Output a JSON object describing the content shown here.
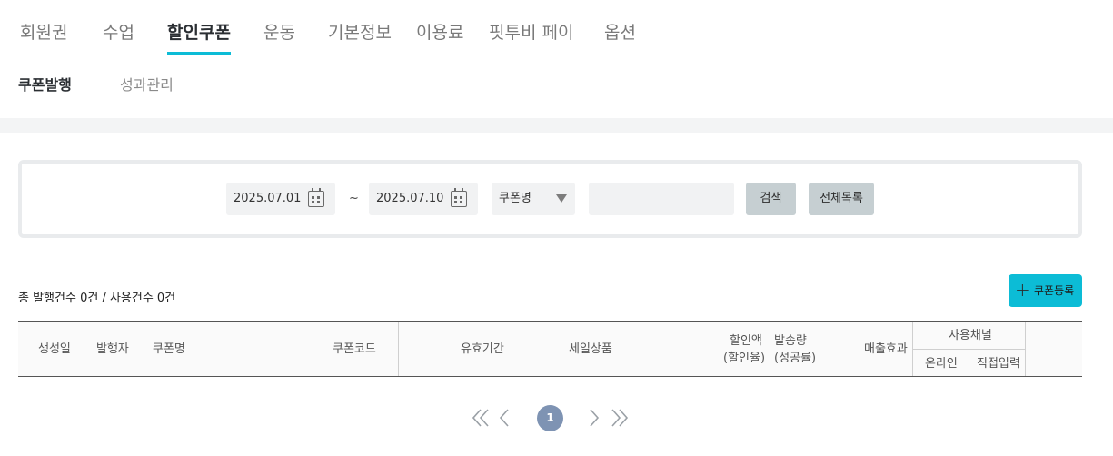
{
  "main_tabs": [
    {
      "label": "회원권",
      "active": false
    },
    {
      "label": "수업",
      "active": false
    },
    {
      "label": "할인쿠폰",
      "active": true
    },
    {
      "label": "운동",
      "active": false
    },
    {
      "label": "기본정보",
      "active": false
    },
    {
      "label": "이용료",
      "active": false
    },
    {
      "label": "핏투비 페이",
      "active": false
    },
    {
      "label": "옵션",
      "active": false
    }
  ],
  "sub_tabs": [
    {
      "label": "쿠폰발행",
      "active": true
    },
    {
      "label": "성과관리",
      "active": false
    }
  ],
  "search": {
    "start_date": "2025.07.01",
    "separator": "~",
    "end_date": "2025.07.10",
    "select_value": "쿠폰명",
    "keyword_value": "",
    "search_label": "검색",
    "all_list_label": "전체목록"
  },
  "summary": "총 발행건수 0건 / 사용건수 0건",
  "register_label": "쿠폰등록",
  "table": {
    "headers": {
      "created": "생성일",
      "issuer": "발행자",
      "coupon_name": "쿠폰명",
      "coupon_code": "쿠폰코드",
      "validity": "유효기간",
      "sale_product": "세일상품",
      "discount_amount": "할인액",
      "discount_rate": "(할인율)",
      "send_count": "발송량",
      "success_rate": "(성공률)",
      "sales_effect": "매출효과",
      "channel": "사용채널",
      "online": "온라인",
      "manual": "직접입력"
    }
  },
  "pagination": {
    "current_page": "1"
  },
  "colors": {
    "accent": "#0cbcd6",
    "button_gray": "#c6cfd2",
    "page_active": "#7e93b3"
  }
}
